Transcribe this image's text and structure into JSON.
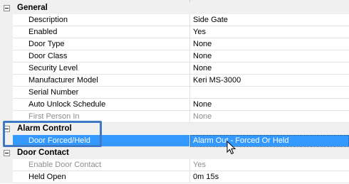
{
  "categories": {
    "general": "General",
    "alarm_control": "Alarm Control",
    "door_contact": "Door Contact"
  },
  "general_rows": [
    {
      "name": "Description",
      "value": "Side Gate"
    },
    {
      "name": "Enabled",
      "value": "Yes"
    },
    {
      "name": "Door Type",
      "value": "None"
    },
    {
      "name": "Door Class",
      "value": "None"
    },
    {
      "name": "Security Level",
      "value": "None"
    },
    {
      "name": "Manufacturer Model",
      "value": "Keri MS-3000"
    },
    {
      "name": "Serial Number",
      "value": ""
    },
    {
      "name": "Auto Unlock Schedule",
      "value": "None"
    },
    {
      "name": "First Person In",
      "value": "None"
    }
  ],
  "alarm_rows": [
    {
      "name": "Door Forced/Held",
      "value": "Alarm Out - Forced Or Held"
    }
  ],
  "door_contact_rows": [
    {
      "name": "Enable Door Contact",
      "value": "Yes"
    },
    {
      "name": "Held Open",
      "value": "0m 15s"
    }
  ],
  "colors": {
    "selection": "#3399ff",
    "callout_border": "#3f78c4",
    "category_background": "#f0f0f0",
    "disabled_text": "#8d8d8d"
  },
  "icons": {
    "expander": "collapse-minus-icon",
    "cursor": "mouse-pointer-icon"
  }
}
